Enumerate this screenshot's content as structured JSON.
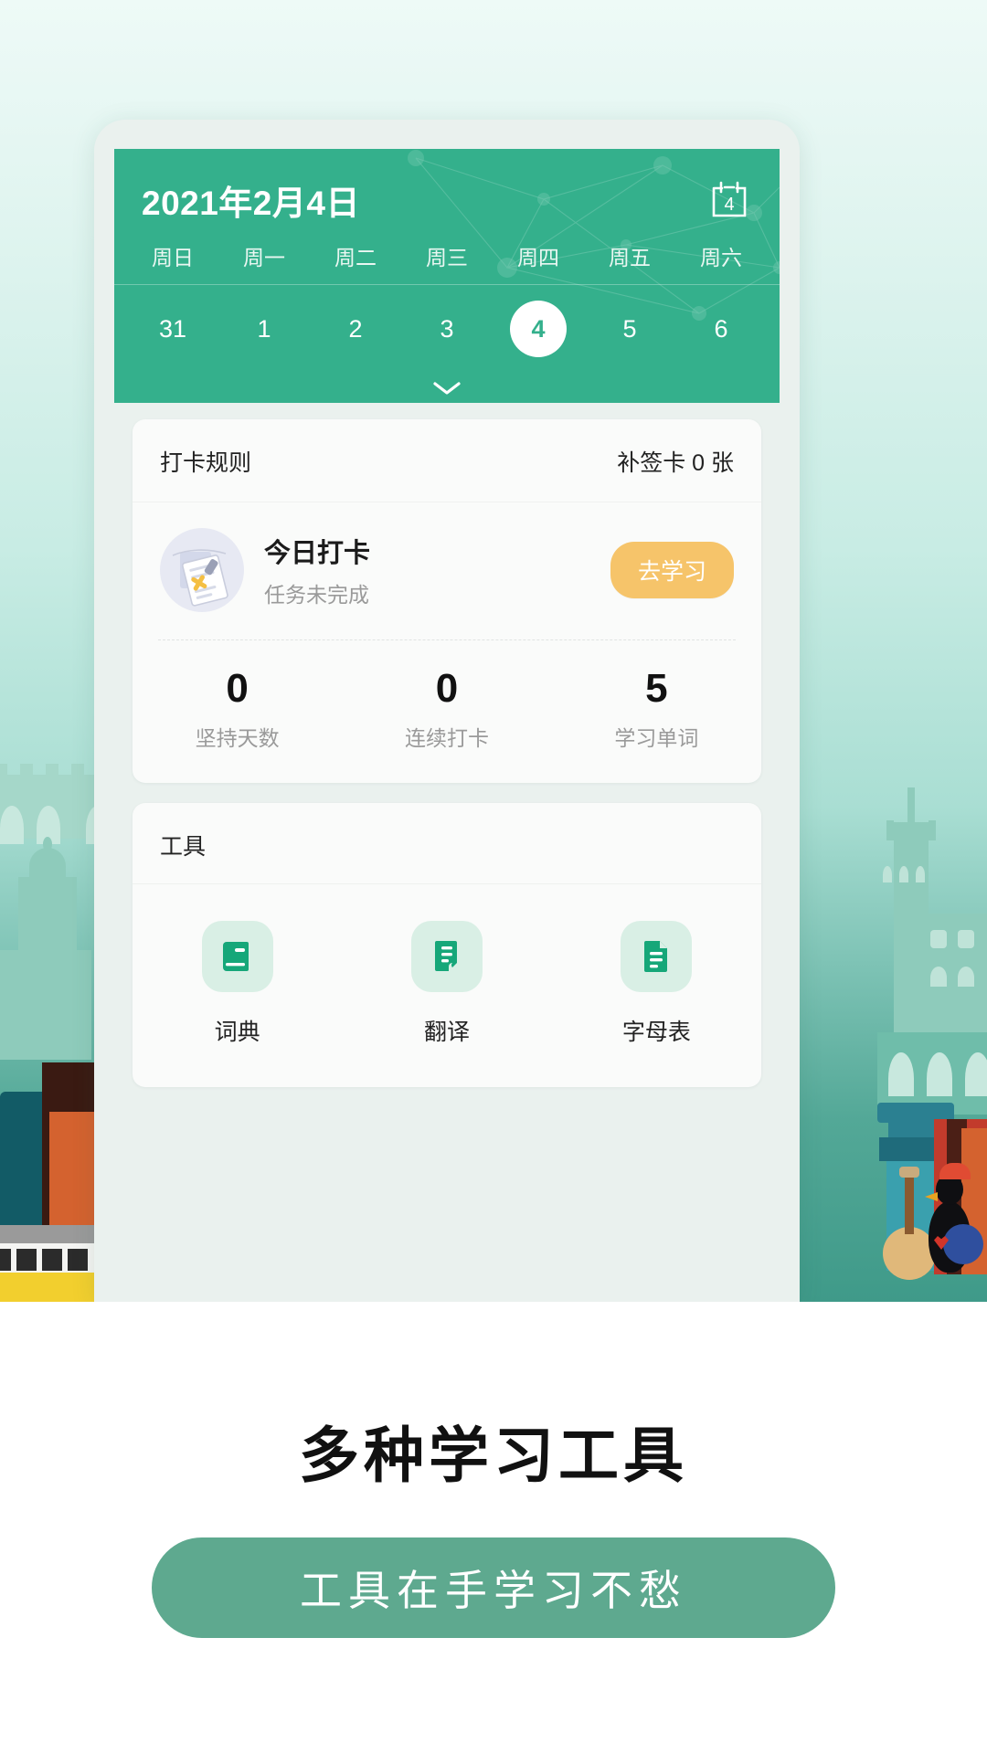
{
  "theme": {
    "brand_green": "#34b08c",
    "pill_green": "#5ea98f",
    "accent_orange": "#f6c46a",
    "page_bg": "#ffffff"
  },
  "calendar": {
    "title": "2021年2月4日",
    "icon": "calendar-icon",
    "icon_day": "4",
    "weekdays": [
      "周日",
      "周一",
      "周二",
      "周三",
      "周四",
      "周五",
      "周六"
    ],
    "dates": [
      {
        "label": "31",
        "selected": false
      },
      {
        "label": "1",
        "selected": false
      },
      {
        "label": "2",
        "selected": false
      },
      {
        "label": "3",
        "selected": false
      },
      {
        "label": "4",
        "selected": true
      },
      {
        "label": "5",
        "selected": false
      },
      {
        "label": "6",
        "selected": false
      }
    ],
    "expand_icon": "chevron-down-icon"
  },
  "checkin": {
    "rules_label": "打卡规则",
    "makeup_cards": "补签卡 0 张",
    "task": {
      "icon": "checklist-document-icon",
      "title": "今日打卡",
      "subtitle": "任务未完成",
      "button_label": "去学习"
    },
    "stats": [
      {
        "value": "0",
        "label": "坚持天数"
      },
      {
        "value": "0",
        "label": "连续打卡"
      },
      {
        "value": "5",
        "label": "学习单词"
      }
    ]
  },
  "tools": {
    "section_title": "工具",
    "items": [
      {
        "label": "词典",
        "icon": "book-icon"
      },
      {
        "label": "翻译",
        "icon": "translate-document-icon"
      },
      {
        "label": "字母表",
        "icon": "file-text-icon"
      }
    ]
  },
  "caption": {
    "headline": "多种学习工具",
    "pill": "工具在手学习不愁"
  }
}
